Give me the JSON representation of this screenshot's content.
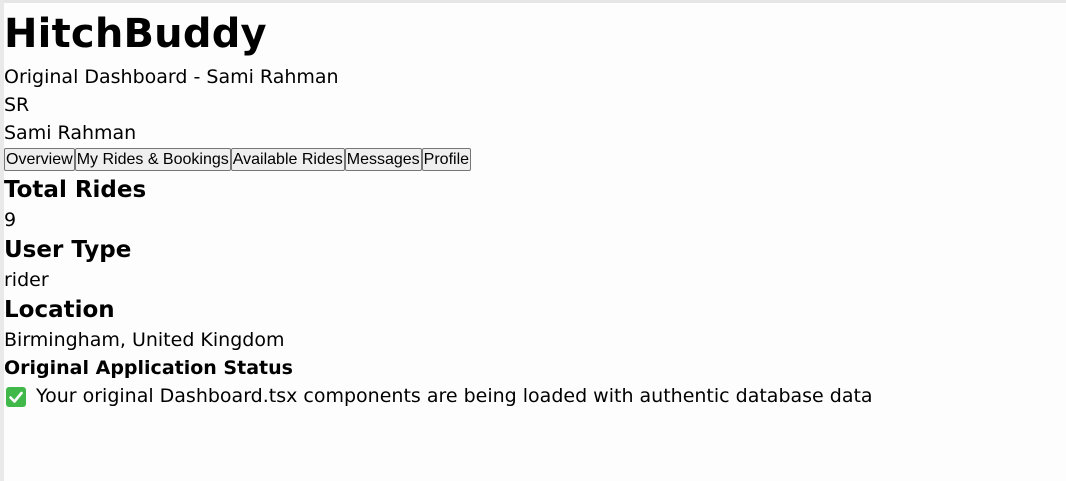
{
  "app": {
    "title": "HitchBuddy",
    "subtitle": "Original Dashboard - Sami Rahman"
  },
  "user": {
    "initials": "SR",
    "name": "Sami Rahman"
  },
  "tabs": [
    {
      "label": "Overview"
    },
    {
      "label": "My Rides & Bookings"
    },
    {
      "label": "Available Rides"
    },
    {
      "label": "Messages"
    },
    {
      "label": "Profile"
    }
  ],
  "stats": {
    "total_rides": {
      "label": "Total Rides",
      "value": "9"
    },
    "user_type": {
      "label": "User Type",
      "value": "rider"
    },
    "location": {
      "label": "Location",
      "value": "Birmingham, United Kingdom"
    }
  },
  "status": {
    "title": "Original Application Status",
    "icon": "check-mark-icon",
    "message": "Your original Dashboard.tsx components are being loaded with authentic database data",
    "icon_color": "#40b94a"
  }
}
